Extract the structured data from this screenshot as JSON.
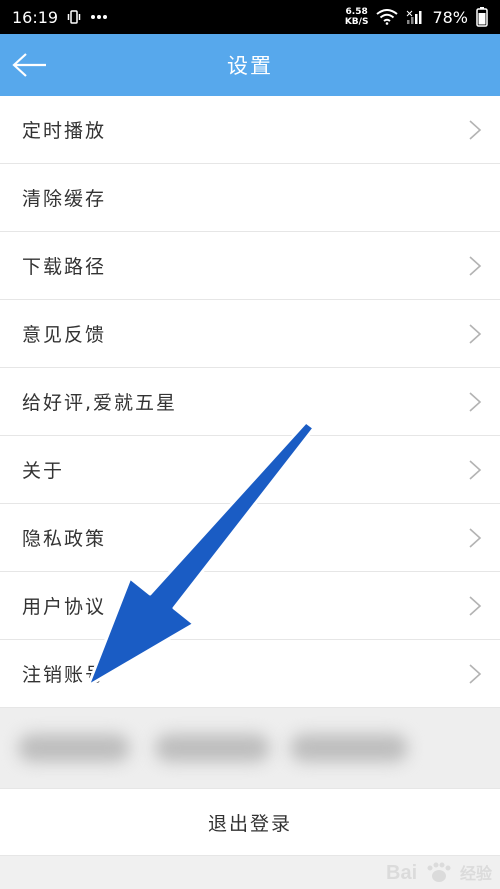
{
  "status_bar": {
    "time": "16:19",
    "net_speed_value": "6.58",
    "net_speed_unit": "KB/S",
    "battery": "78%",
    "icons": [
      "vibrate-icon",
      "more-dots-icon",
      "wifi-icon",
      "signal-icon",
      "battery-icon"
    ]
  },
  "header": {
    "title": "设置",
    "back_icon": "arrow-left-icon"
  },
  "menu": {
    "items": [
      {
        "label": "定时播放",
        "has_chevron": true
      },
      {
        "label": "清除缓存",
        "has_chevron": false
      },
      {
        "label": "下载路径",
        "has_chevron": true
      },
      {
        "label": "意见反馈",
        "has_chevron": true
      },
      {
        "label": "给好评,爱就五星",
        "has_chevron": true
      },
      {
        "label": "关于",
        "has_chevron": true
      },
      {
        "label": "隐私政策",
        "has_chevron": true
      },
      {
        "label": "用户协议",
        "has_chevron": true
      },
      {
        "label": "注销账号",
        "has_chevron": true
      }
    ]
  },
  "logout": {
    "label": "退出登录"
  },
  "watermark": {
    "text": "经验"
  },
  "colors": {
    "header_bg": "#57a8ec",
    "arrow": "#1a5cc4",
    "chevron": "#b3b3b3"
  }
}
